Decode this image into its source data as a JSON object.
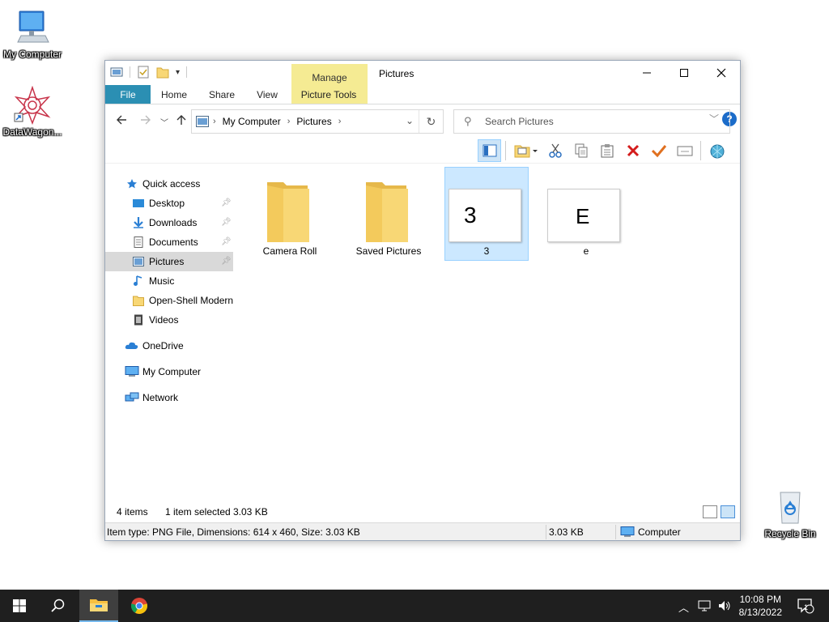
{
  "desktop": {
    "icons": [
      {
        "label": "My Computer"
      },
      {
        "label": "DataWagon..."
      },
      {
        "label": "Recycle Bin"
      }
    ]
  },
  "window": {
    "title": "Pictures",
    "context_tab": "Manage",
    "ribbon_tabs": [
      "File",
      "Home",
      "Share",
      "View",
      "Picture Tools"
    ],
    "help": "?",
    "breadcrumb": [
      "My Computer",
      "Pictures"
    ],
    "search_placeholder": "Search Pictures",
    "sidebar": {
      "items": [
        {
          "label": "Quick access",
          "icon": "star-icon"
        },
        {
          "label": "Desktop",
          "icon": "desktop-icon"
        },
        {
          "label": "Downloads",
          "icon": "download-icon"
        },
        {
          "label": "Documents",
          "icon": "document-icon"
        },
        {
          "label": "Pictures",
          "icon": "pictures-icon"
        },
        {
          "label": "Music",
          "icon": "music-icon"
        },
        {
          "label": "Open-Shell Modern",
          "icon": "folder-icon"
        },
        {
          "label": "Videos",
          "icon": "video-icon"
        },
        {
          "label": "OneDrive",
          "icon": "cloud-icon"
        },
        {
          "label": "My Computer",
          "icon": "computer-icon"
        },
        {
          "label": "Network",
          "icon": "network-icon"
        }
      ],
      "selected": "Pictures"
    },
    "files": [
      {
        "name": "Camera Roll",
        "type": "folder"
      },
      {
        "name": "Saved Pictures",
        "type": "folder"
      },
      {
        "name": "3",
        "type": "image",
        "thumb_text": "3"
      },
      {
        "name": "e",
        "type": "image",
        "thumb_text": "E"
      }
    ],
    "status": {
      "count": "4 items",
      "selection": "1 item selected",
      "size": "3.03 KB"
    },
    "details_bar": {
      "info": "Item type: PNG File, Dimensions: 614 x 460, Size: 3.03 KB",
      "size": "3.03 KB",
      "location": "Computer"
    }
  },
  "taskbar": {
    "time": "10:08 PM",
    "date": "8/13/2022",
    "notifications": "1"
  },
  "colors": {
    "file_tab": "#2b8fb3",
    "context_tab": "#f5eb93",
    "selection": "#cce8ff",
    "taskbar": "#1f1f1f",
    "folder": "#f8d775"
  }
}
